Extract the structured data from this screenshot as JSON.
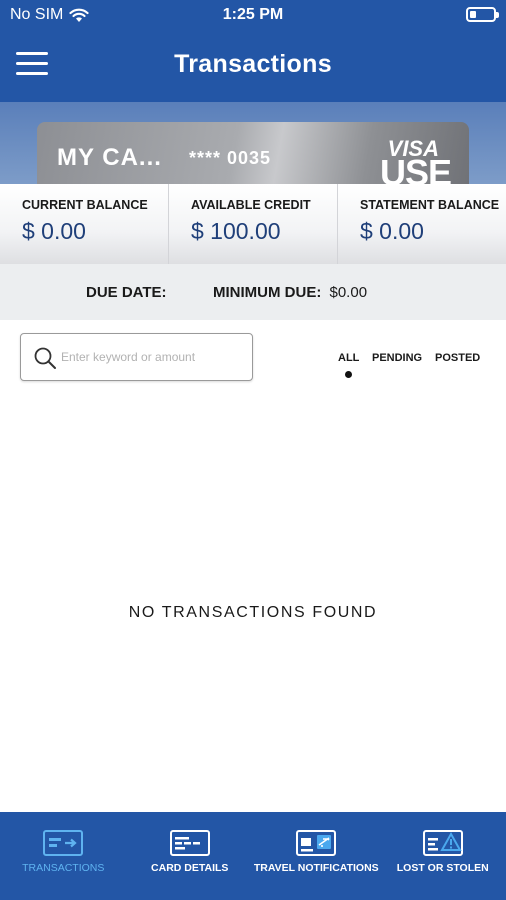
{
  "status_bar": {
    "carrier": "No SIM",
    "time": "1:25 PM",
    "icons": [
      "wifi-icon",
      "battery-icon"
    ]
  },
  "header": {
    "title": "Transactions",
    "menu_icon": "hamburger-menu-icon"
  },
  "card": {
    "name": "MY CA...",
    "masked_number": "**** 0035",
    "network": "VISA",
    "brand": "USE"
  },
  "balances": [
    {
      "label": "CURRENT BALANCE",
      "value": "$ 0.00"
    },
    {
      "label": "AVAILABLE CREDIT",
      "value": "$ 100.00"
    },
    {
      "label": "STATEMENT BALANCE",
      "value": "$ 0.00"
    }
  ],
  "due": {
    "due_date_label": "DUE DATE:",
    "minimum_due_label": "MINIMUM DUE:",
    "minimum_due_value": "$0.00"
  },
  "search": {
    "placeholder": "Enter keyword or amount",
    "value": ""
  },
  "filters": {
    "all": "ALL",
    "pending": "PENDING",
    "posted": "POSTED",
    "selected": "ALL"
  },
  "empty_message": "NO TRANSACTIONS FOUND",
  "tabs": [
    {
      "label": "TRANSACTIONS",
      "icon": "transactions-icon",
      "active": true
    },
    {
      "label": "CARD DETAILS",
      "icon": "card-details-icon",
      "active": false
    },
    {
      "label": "TRAVEL NOTIFICATIONS",
      "icon": "travel-notifications-icon",
      "active": false
    },
    {
      "label": "LOST OR STOLEN",
      "icon": "lost-or-stolen-icon",
      "active": false
    }
  ],
  "colors": {
    "primary_blue": "#2356a6",
    "active_tab": "#5fb3f0",
    "balance_text": "#1f3f79"
  }
}
